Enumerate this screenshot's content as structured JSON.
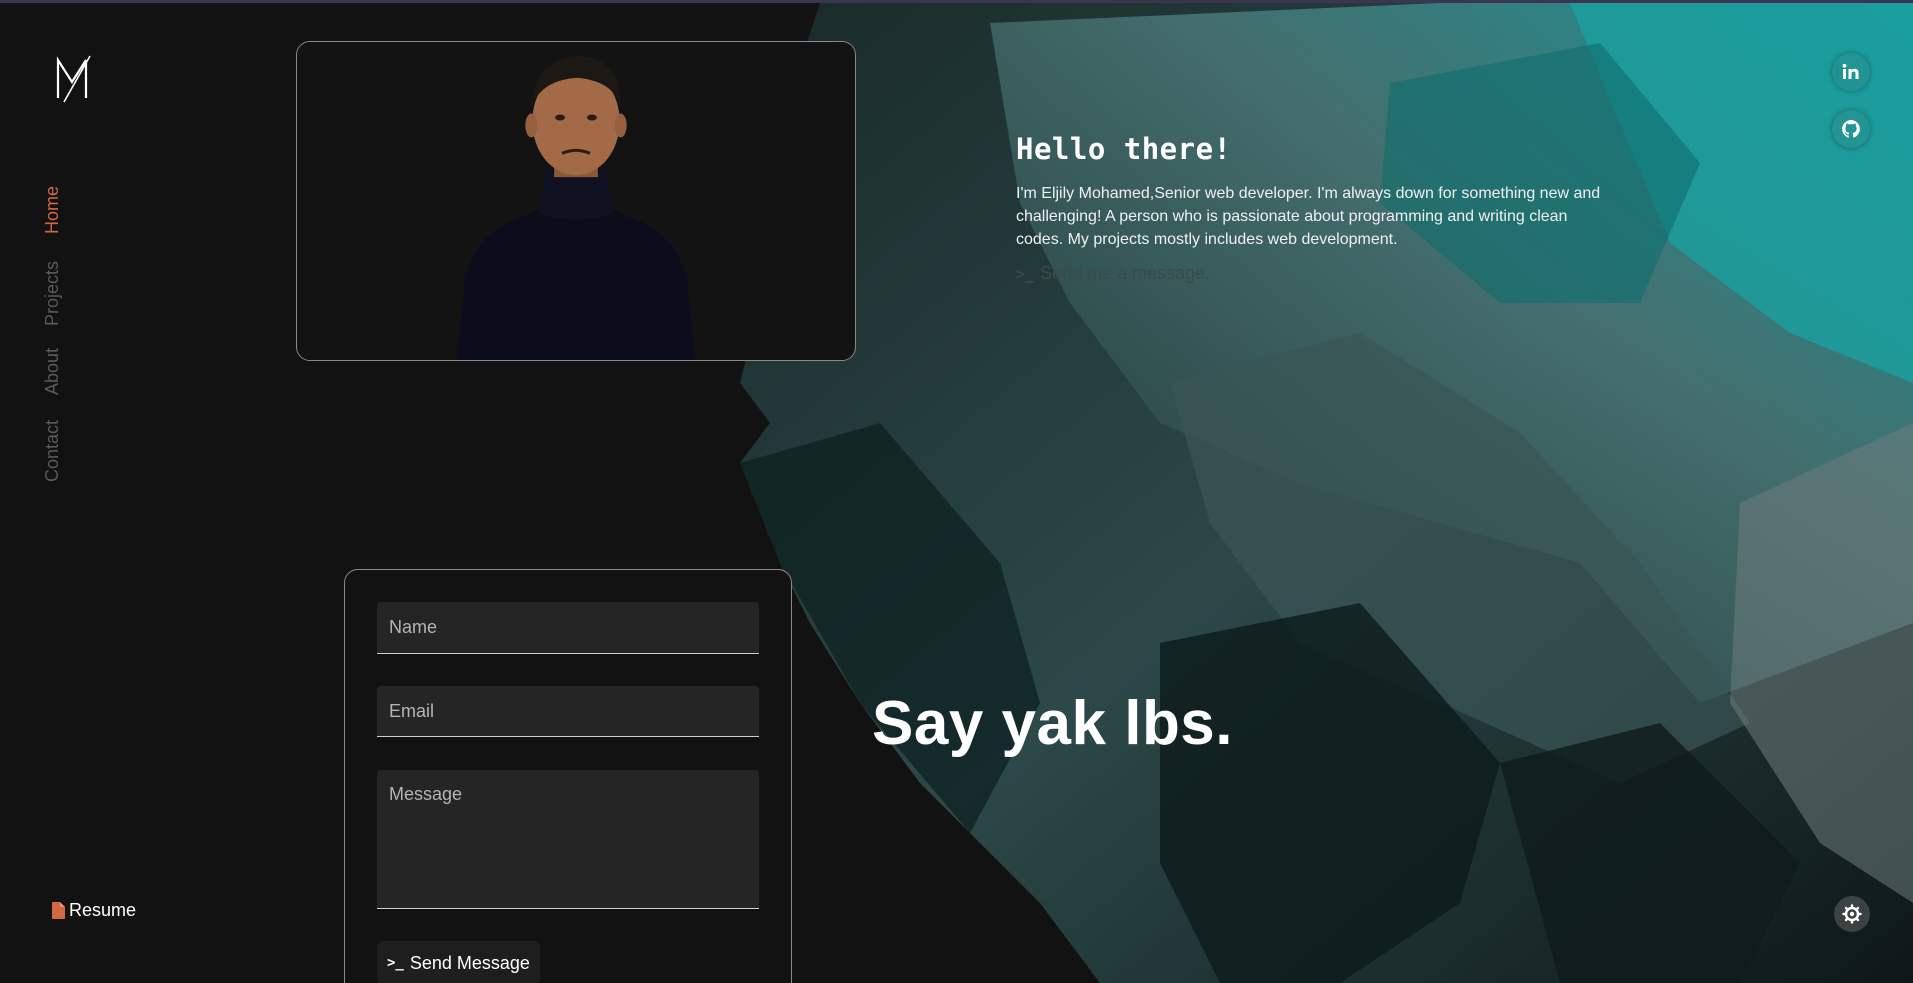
{
  "nav": {
    "items": [
      {
        "label": "Home",
        "active": true
      },
      {
        "label": "Projects",
        "active": false
      },
      {
        "label": "About",
        "active": false
      },
      {
        "label": "Contact",
        "active": false
      }
    ],
    "active_color": "#d06a45"
  },
  "resume": {
    "label": "Resume",
    "icon": "file-icon"
  },
  "intro": {
    "heading": "Hello there!",
    "bio": "I'm Eljily Mohamed,Senior web developer. I'm always down for something new and challenging! A person who is passionate about programming and writing clean codes. My projects mostly includes web development.",
    "cta_prefix": ">_",
    "cta_label": "Send me a message."
  },
  "social": [
    {
      "icon": "linkedin-icon"
    },
    {
      "icon": "github-icon"
    }
  ],
  "settings": {
    "icon": "settings-icon"
  },
  "form": {
    "name_placeholder": "Name",
    "email_placeholder": "Email",
    "message_placeholder": "Message",
    "send_prefix": ">_",
    "send_label": "Send Message"
  },
  "tagline": "Say yak lbs.",
  "colors": {
    "background": "#121212",
    "teal": "#1f9a9a",
    "accent": "#d06a45"
  }
}
